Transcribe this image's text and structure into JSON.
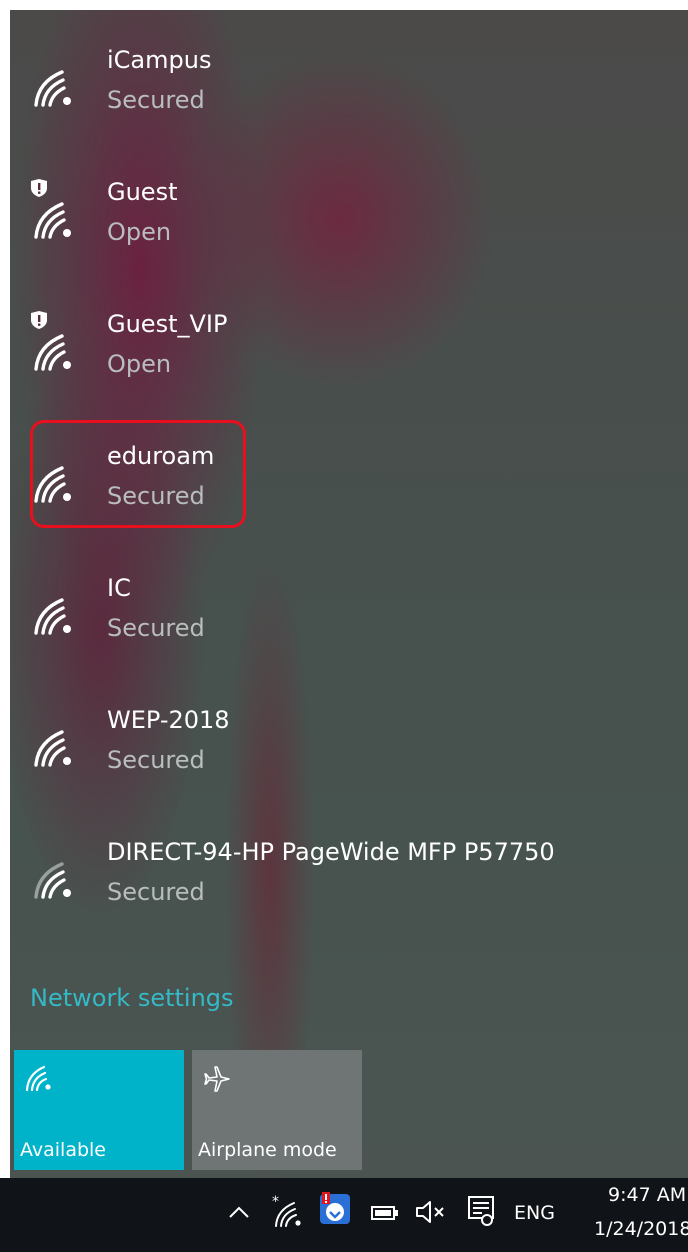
{
  "networks": [
    {
      "name": "iCampus",
      "status": "Secured",
      "shield": false
    },
    {
      "name": "Guest",
      "status": "Open",
      "shield": true
    },
    {
      "name": "Guest_VIP",
      "status": "Open",
      "shield": true
    },
    {
      "name": "eduroam",
      "status": "Secured",
      "shield": false,
      "highlighted": true
    },
    {
      "name": "IC",
      "status": "Secured",
      "shield": false
    },
    {
      "name": "WEP-2018",
      "status": "Secured",
      "shield": false
    },
    {
      "name": "DIRECT-94-HP PageWide MFP P57750",
      "status": "Secured",
      "shield": false
    }
  ],
  "network_settings_label": "Network settings",
  "quick_actions": {
    "wifi_label": "Available",
    "airplane_label": "Airplane mode"
  },
  "taskbar": {
    "language": "ENG",
    "time": "9:47 AM",
    "date": "1/24/2018"
  },
  "icons": {
    "network": "wifi-icon",
    "shield": "shield-warning-icon",
    "airplane": "airplane-icon",
    "chevron": "chevron-up-icon",
    "battery": "battery-icon",
    "volume": "volume-muted-icon",
    "notifications": "action-center-icon"
  },
  "colors": {
    "accent": "#00b3c8",
    "link": "#35b9c7",
    "highlight_border": "#e8101e",
    "taskbar": "#101317"
  }
}
